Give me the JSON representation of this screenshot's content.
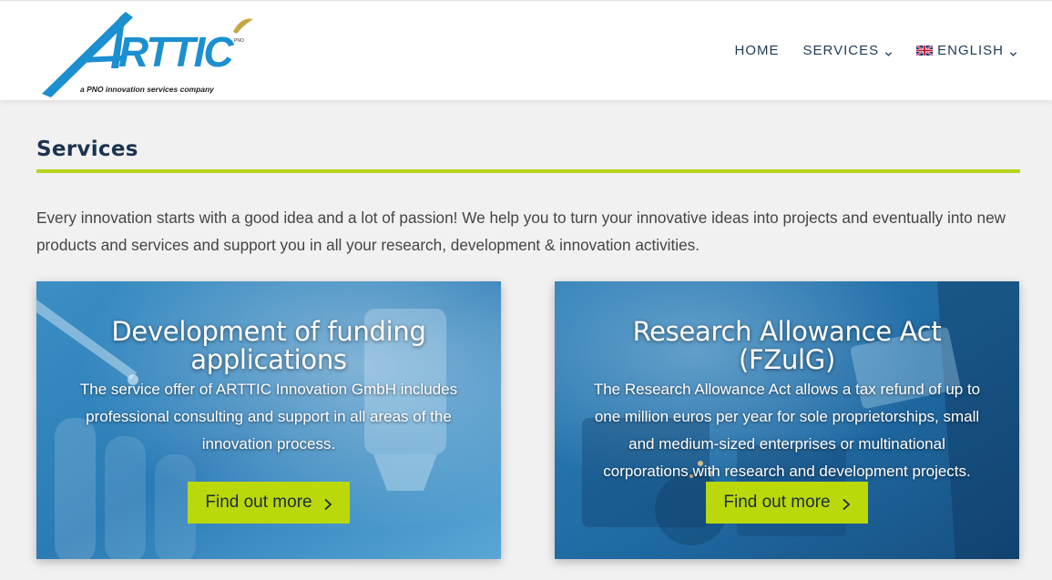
{
  "header": {
    "logo": {
      "wordmark": "ARTTIC",
      "tagline": "a PNO innovation services company",
      "badge": "PNO"
    },
    "nav": {
      "home": "HOME",
      "services": "SERVICES",
      "language": "ENGLISH"
    }
  },
  "page": {
    "title": "Services",
    "intro": "Every innovation starts with a good idea and a lot of passion! We help you to turn your innovative ideas into projects and eventually into new products and services and support you in all your research, development & innovation activities."
  },
  "cards": [
    {
      "title": "Development of funding applications",
      "text": "The service offer of ARTTIC Innovation GmbH includes professional consulting and support in all areas of the innovation process.",
      "button": "Find out more"
    },
    {
      "title": "Research Allowance Act (FZulG)",
      "text": "The Research Allowance Act allows a tax refund of up to one million euros per year for sole proprietorships, small and medium-sized enterprises or multinational corporations with research and development projects.",
      "button": "Find out more"
    }
  ],
  "colors": {
    "accent": "#b9d31c",
    "button": "#bad80a",
    "navText": "#1f3a57",
    "heading": "#1b3350",
    "logoBlue": "#1b8fd0"
  },
  "icons": {
    "services_chevron": "chevron-down-icon",
    "language_chevron": "chevron-down-icon",
    "language_flag": "uk-flag-icon",
    "button_arrow": "chevron-right-icon"
  }
}
